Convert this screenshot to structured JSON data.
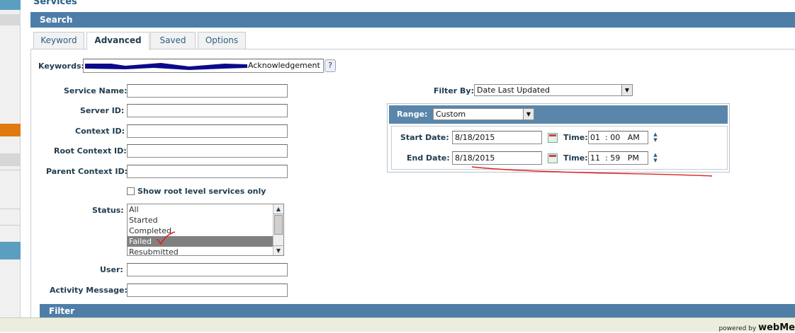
{
  "page": {
    "title": "Services"
  },
  "search": {
    "header": "Search"
  },
  "tabs": [
    {
      "label": "Keyword"
    },
    {
      "label": "Advanced"
    },
    {
      "label": "Saved"
    },
    {
      "label": "Options"
    }
  ],
  "form": {
    "keywords_label": "Keywords:",
    "keywords_value": "Acknowledgement",
    "help_label": "?",
    "service_name_label": "Service Name:",
    "server_id_label": "Server ID:",
    "context_id_label": "Context ID:",
    "root_context_id_label": "Root Context ID:",
    "parent_context_id_label": "Parent Context ID:",
    "show_root_label": "Show root level services only",
    "status_label": "Status:",
    "status_options": [
      "All",
      "Started",
      "Completed",
      "Failed",
      "Resubmitted"
    ],
    "status_selected": "Failed",
    "user_label": "User:",
    "activity_message_label": "Activity Message:"
  },
  "filter": {
    "filter_by_label": "Filter By:",
    "filter_by_value": "Date Last Updated",
    "range_label": "Range:",
    "range_value": "Custom",
    "start_date_label": "Start Date:",
    "start_date_value": "8/18/2015",
    "end_date_label": "End Date:",
    "end_date_value": "8/18/2015",
    "time_label": "Time:",
    "start_time": {
      "hour": "01",
      "minute": "00",
      "ampm": "AM"
    },
    "end_time": {
      "hour": "11",
      "minute": "59",
      "ampm": "PM"
    }
  },
  "filter_section": {
    "header": "Filter"
  },
  "footer": {
    "powered_by": "powered by",
    "brand": "webMe"
  },
  "colors": {
    "header_blue": "#4e7ea8",
    "sidebar_orange": "#e07a10",
    "annotation_red": "#e02020"
  }
}
